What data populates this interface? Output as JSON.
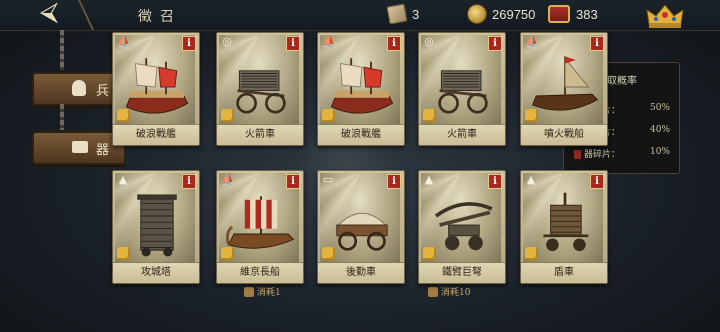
{
  "header": {
    "title": "徵召",
    "scrolls": "3",
    "gold": "269750",
    "gems": "383"
  },
  "sidebar": {
    "items": [
      {
        "label": "兵"
      },
      {
        "label": "器"
      }
    ]
  },
  "side_panel": {
    "title": "取概率",
    "rows": [
      {
        "label": "械碎片：",
        "value": "50%"
      },
      {
        "label": "械碎片：",
        "value": "40%"
      },
      {
        "label": "器碎片：",
        "value": "10%"
      }
    ]
  },
  "bottom": {
    "cost_left": "消耗1",
    "cost_right": "消耗10"
  },
  "cards": [
    {
      "name": "破浪戰艦",
      "type_icon": "ship-type-icon",
      "unit": "galleon"
    },
    {
      "name": "火箭車",
      "type_icon": "ranged-type-icon",
      "unit": "rocket-cart"
    },
    {
      "name": "破浪戰艦",
      "type_icon": "ship-type-icon",
      "unit": "galleon"
    },
    {
      "name": "火箭車",
      "type_icon": "ranged-type-icon",
      "unit": "rocket-cart"
    },
    {
      "name": "噴火戰船",
      "type_icon": "ship-type-icon",
      "unit": "fire-ship"
    },
    {
      "name": "攻城塔",
      "type_icon": "siege-type-icon",
      "unit": "siege-tower"
    },
    {
      "name": "維京長船",
      "type_icon": "ship-type-icon",
      "unit": "longship"
    },
    {
      "name": "後勤車",
      "type_icon": "support-type-icon",
      "unit": "wagon"
    },
    {
      "name": "鐵臂巨弩",
      "type_icon": "siege-type-icon",
      "unit": "ballista"
    },
    {
      "name": "盾車",
      "type_icon": "siege-type-icon",
      "unit": "shield-cart"
    }
  ],
  "colors": {
    "accent": "#a8281d",
    "card_bg": "#cfc39c",
    "puzzle": "#e2b43c"
  }
}
